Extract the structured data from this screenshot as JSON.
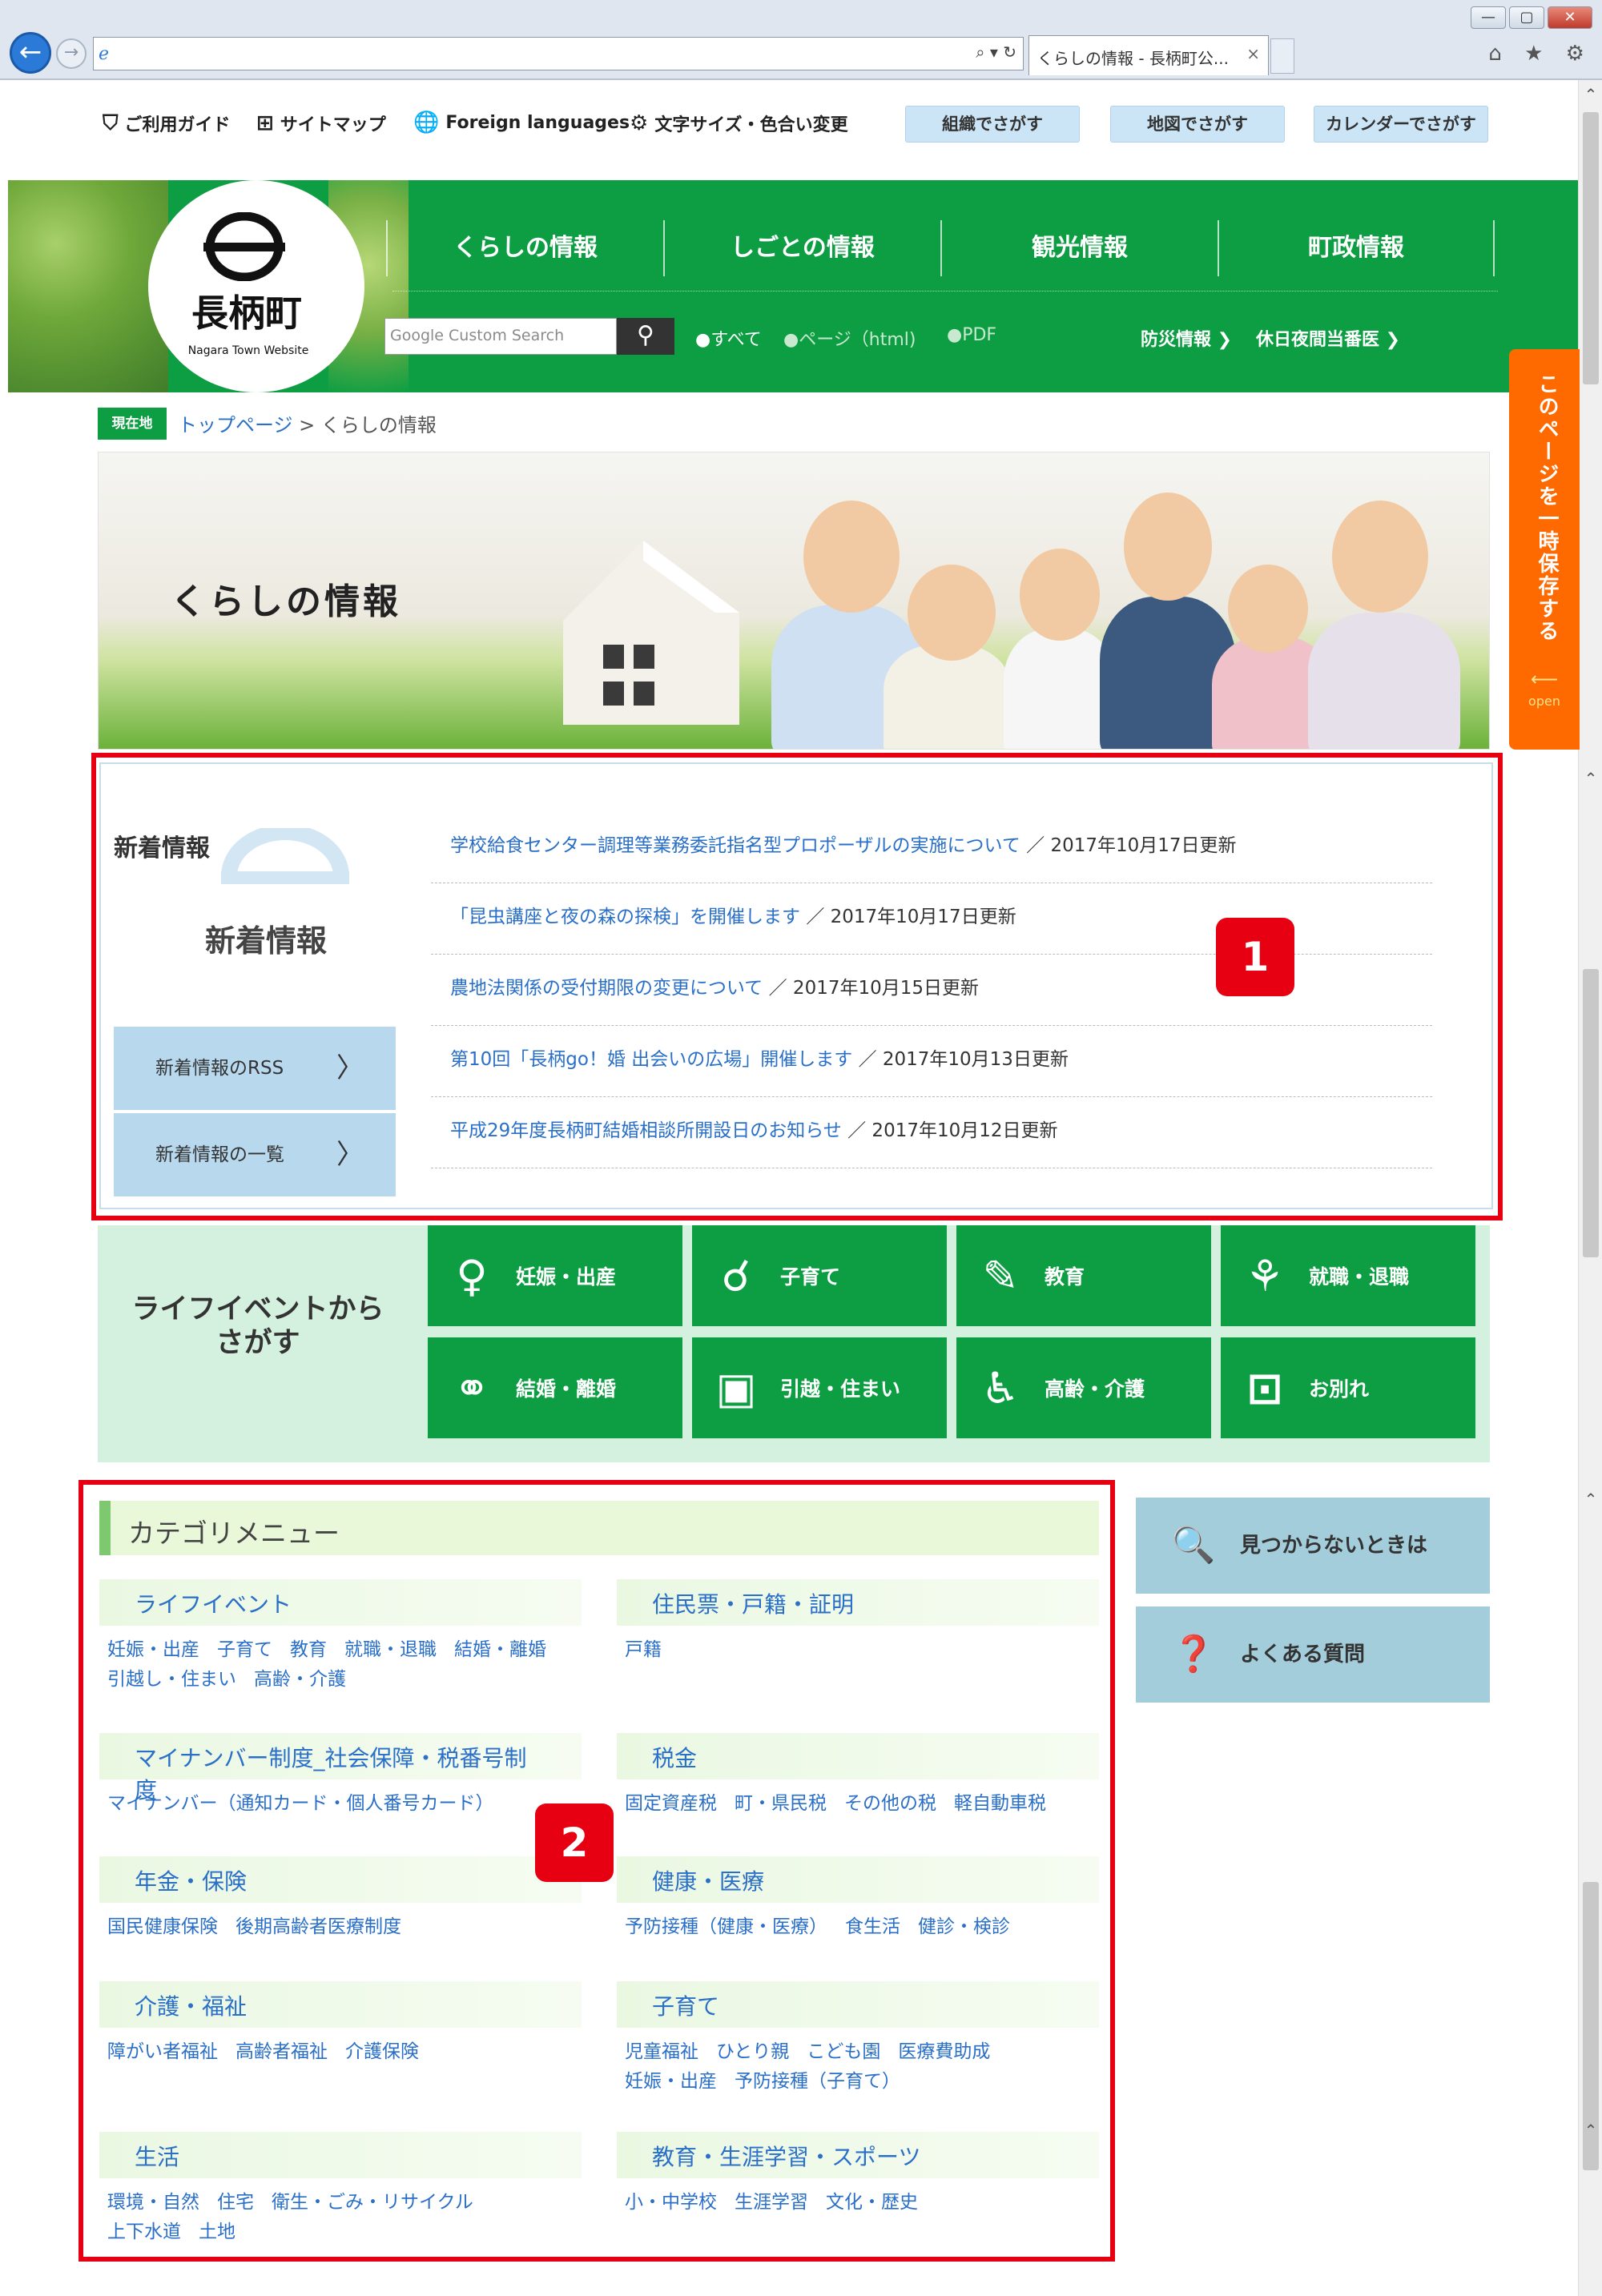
{
  "browser": {
    "tab_title": "くらしの情報 - 長柄町公...",
    "tab_close": "×",
    "address_tools": "⌕ ▾ ↻",
    "window_buttons": [
      "—",
      "▢",
      "✕"
    ],
    "toolbar_icons": "⌂ ★ ⚙"
  },
  "utility": {
    "guide": "ご利用ガイド",
    "sitemap": "サイトマップ",
    "foreign": "Foreign languages",
    "textsize": "文字サイズ・色合い変更",
    "btn_org": "組織でさがす",
    "btn_map": "地図でさがす",
    "btn_cal": "カレンダーでさがす"
  },
  "logo": {
    "name": "長柄町",
    "sub": "Nagara Town Website"
  },
  "gnav": [
    "くらしの情報",
    "しごとの情報",
    "観光情報",
    "町政情報"
  ],
  "search": {
    "placeholder": "Google Custom Search",
    "button": "⚲",
    "radio_all": "●すべて",
    "radio_page": "●ページ（html)",
    "radio_pdf": "●PDF"
  },
  "header_links": {
    "disaster": "防災情報 ❯",
    "holiday": "休日夜間当番医 ❯"
  },
  "side_tab": {
    "label": "このページを一時保存する",
    "open": "open"
  },
  "breadcrumb": {
    "badge": "現在地",
    "home": "トップページ",
    "sep": " > ",
    "current": "くらしの情報"
  },
  "hero": {
    "title": "くらしの情報"
  },
  "news": {
    "label": "新着情報",
    "big_label": "新着情報",
    "rss": "新着情報のRSS",
    "list_btn": "新着情報の一覧",
    "chevron": "〉",
    "items": [
      {
        "title": "学校給食センター調理等業務委託指名型プロポーザルの実施について",
        "date": "／ 2017年10月17日更新"
      },
      {
        "title": "「昆虫講座と夜の森の探検」を開催します",
        "date": "／ 2017年10月17日更新"
      },
      {
        "title": "農地法関係の受付期限の変更について",
        "date": "／ 2017年10月15日更新"
      },
      {
        "title": "第10回「長柄go！婚 出会いの広場」開催します",
        "date": "／ 2017年10月13日更新"
      },
      {
        "title": "平成29年度長柄町結婚相談所開設日のお知らせ",
        "date": "／ 2017年10月12日更新"
      }
    ]
  },
  "life": {
    "title": "ライフイベントからさがす",
    "buttons": [
      "妊娠・出産",
      "子育て",
      "教育",
      "就職・退職",
      "結婚・離婚",
      "引越・住まい",
      "高齢・介護",
      "お別れ"
    ]
  },
  "category": {
    "title": "カテゴリメニュー",
    "groups": [
      {
        "head": "ライフイベント",
        "links": [
          "妊娠・出産",
          "子育て",
          "教育",
          "就職・退職",
          "結婚・離婚",
          "引越し・住まい",
          "高齢・介護"
        ]
      },
      {
        "head": "住民票・戸籍・証明",
        "links": [
          "戸籍"
        ]
      },
      {
        "head": "マイナンバー制度_社会保障・税番号制度",
        "links": [
          "マイナンバー（通知カード・個人番号カード）"
        ]
      },
      {
        "head": "税金",
        "links": [
          "固定資産税",
          "町・県民税",
          "その他の税",
          "軽自動車税"
        ]
      },
      {
        "head": "年金・保険",
        "links": [
          "国民健康保険",
          "後期高齢者医療制度"
        ]
      },
      {
        "head": "健康・医療",
        "links": [
          "予防接種（健康・医療）",
          "食生活",
          "健診・検診"
        ]
      },
      {
        "head": "介護・福祉",
        "links": [
          "障がい者福祉",
          "高齢者福祉",
          "介護保険"
        ]
      },
      {
        "head": "子育て",
        "links": [
          "児童福祉",
          "ひとり親",
          "こども園",
          "医療費助成",
          "妊娠・出産",
          "予防接種（子育て）"
        ]
      },
      {
        "head": "生活",
        "links": [
          "環境・自然",
          "住宅",
          "衛生・ごみ・リサイクル",
          "上下水道",
          "土地"
        ]
      },
      {
        "head": "教育・生涯学習・スポーツ",
        "links": [
          "小・中学校",
          "生涯学習",
          "文化・歴史"
        ]
      }
    ]
  },
  "right_cards": {
    "notfound": "見つからないときは",
    "faq": "よくある質問"
  },
  "badges": [
    "1",
    "2"
  ],
  "colors": {
    "brand_green": "#0d9e43",
    "highlight_red": "#e60012",
    "side_tab_orange": "#ff6a00",
    "link_blue": "#2a6fc8"
  }
}
